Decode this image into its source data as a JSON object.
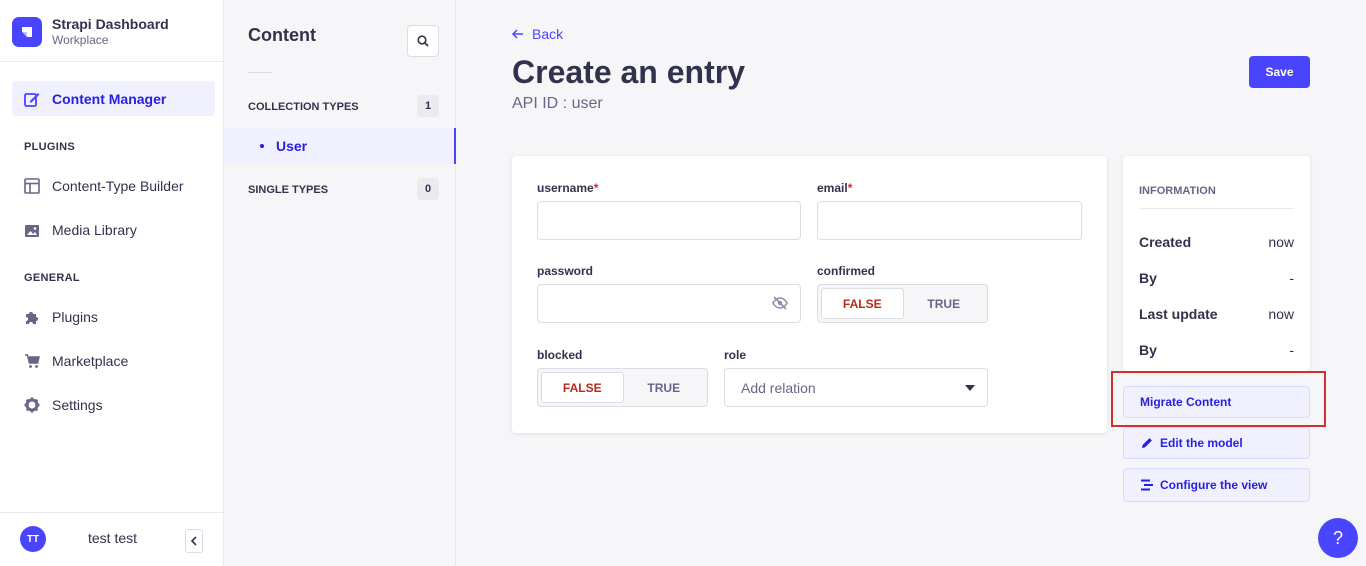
{
  "brand": {
    "title": "Strapi Dashboard",
    "subtitle": "Workplace"
  },
  "mainnav": {
    "content_manager": "Content Manager",
    "plugins_section": "PLUGINS",
    "content_type_builder": "Content-Type Builder",
    "media_library": "Media Library",
    "general_section": "GENERAL",
    "plugins": "Plugins",
    "marketplace": "Marketplace",
    "settings": "Settings"
  },
  "user": {
    "initials": "TT",
    "name": "test test"
  },
  "subnav": {
    "title": "Content",
    "collection_types": "COLLECTION TYPES",
    "collection_count": "1",
    "user_link": "User",
    "single_types": "SINGLE TYPES",
    "single_count": "0"
  },
  "header": {
    "back": "Back",
    "title": "Create an entry",
    "api_id": "API ID : user",
    "save": "Save"
  },
  "form": {
    "username_label": "username",
    "email_label": "email",
    "required_mark": "*",
    "password_label": "password",
    "confirmed_label": "confirmed",
    "blocked_label": "blocked",
    "role_label": "role",
    "false_label": "FALSE",
    "true_label": "TRUE",
    "role_placeholder": "Add relation",
    "username_value": "",
    "email_value": "",
    "password_value": ""
  },
  "info": {
    "title": "INFORMATION",
    "created_key": "Created",
    "created_val": "now",
    "by1_key": "By",
    "by1_val": "-",
    "updated_key": "Last update",
    "updated_val": "now",
    "by2_key": "By",
    "by2_val": "-"
  },
  "side_actions": {
    "migrate": "Migrate Content",
    "edit_model": "Edit the model",
    "configure_view": "Configure the view"
  },
  "help": "?",
  "colors": {
    "primary": "#4945ff",
    "primary_light": "#f0f0ff",
    "danger": "#d02b20",
    "highlight": "#d32f2f"
  }
}
